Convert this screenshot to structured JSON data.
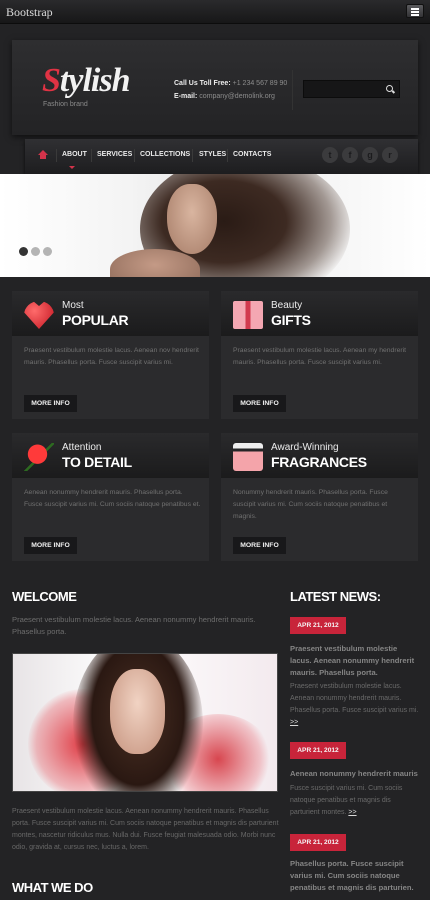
{
  "topbar": {
    "brand": "Bootstrap"
  },
  "header": {
    "logo_first": "S",
    "logo_rest": "tylish",
    "tagline": "Fashion brand",
    "phone_label": "Call Us Toll Free:",
    "phone": "+1 234 567 89 90",
    "email_label": "E-mail:",
    "email": "company@demolink.org",
    "search_placeholder": ""
  },
  "nav": {
    "items": [
      "ABOUT",
      "SERVICES",
      "COLLECTIONS",
      "STYLES",
      "CONTACTS"
    ],
    "active": "ABOUT",
    "social": [
      "t",
      "f",
      "g",
      "r"
    ]
  },
  "slider": {
    "slides": 3,
    "active_index": 0
  },
  "features": [
    {
      "small": "Most",
      "big": "POPULAR",
      "text": "Praesent vestibulum molestie lacus. Aenean nov hendrerit mauris. Phasellus porta. Fusce suscipit varius mi.",
      "button": "MORE INFO",
      "icon": "heart-icon"
    },
    {
      "small": "Beauty",
      "big": "GIFTS",
      "text": "Praesent vestibulum molestie lacus. Aenean my hendrerit mauris. Phasellus porta. Fusce suscipit varius mi.",
      "button": "MORE INFO",
      "icon": "gift-icon"
    },
    {
      "small": "Attention",
      "big": "TO DETAIL",
      "text": "Aenean nonummy hendrerit mauris. Phasellus porta. Fusce suscipit varius mi. Cum sociis natoque penatibus et.",
      "button": "MORE INFO",
      "icon": "rose-icon"
    },
    {
      "small": "Award-Winning",
      "big": "FRAGRANCES",
      "text": "Nonummy hendrerit mauris. Phasellus porta. Fusce suscipit varius mi. Cum sociis natoque penatibus et magnis.",
      "button": "MORE INFO",
      "icon": "perfume-icon"
    }
  ],
  "welcome": {
    "title": "WELCOME",
    "intro": "Praesent vestibulum molestie lacus. Aenean nonummy hendrerit mauris. Phasellus porta.",
    "body": "Praesent vestibulum molestie lacus. Aenean nonummy hendrerit mauris. Phasellus porta. Fusce suscipit varius mi. Cum sociis natoque penatibus et magnis dis parturient montes, nascetur ridiculus mus. Nulla dui. Fusce feugiat malesuada odio. Morbi nunc odio, gravida at, cursus nec, luctus a, lorem."
  },
  "what_we_do": {
    "title": "WHAT WE DO"
  },
  "news": {
    "title": "LATEST NEWS:",
    "items": [
      {
        "date": "APR 21, 2012",
        "headline": "Praesent vestibulum molestie lacus. Aenean nonummy hendrerit mauris. Phasellus porta.",
        "text": "Praesent vestibulum molestie lacus. Aenean nonummy hendrerit mauris. Phasellus porta. Fusce suscipit varius mi.",
        "more": ">>"
      },
      {
        "date": "APR 21, 2012",
        "headline": "Aenean nonummy hendrerit mauris",
        "text": "Fusce suscipit varius mi. Cum sociis natoque penatibus et magnis dis parturient montes.",
        "more": ">>"
      },
      {
        "date": "APR 21, 2012",
        "headline": "Phasellus porta. Fusce suscipit varius mi. Cum sociis natoque penatibus et magnis dis parturien.",
        "text": "",
        "more": ""
      }
    ]
  },
  "colors": {
    "accent": "#c8243a",
    "background": "#232325",
    "panel": "#2b2b2d"
  }
}
